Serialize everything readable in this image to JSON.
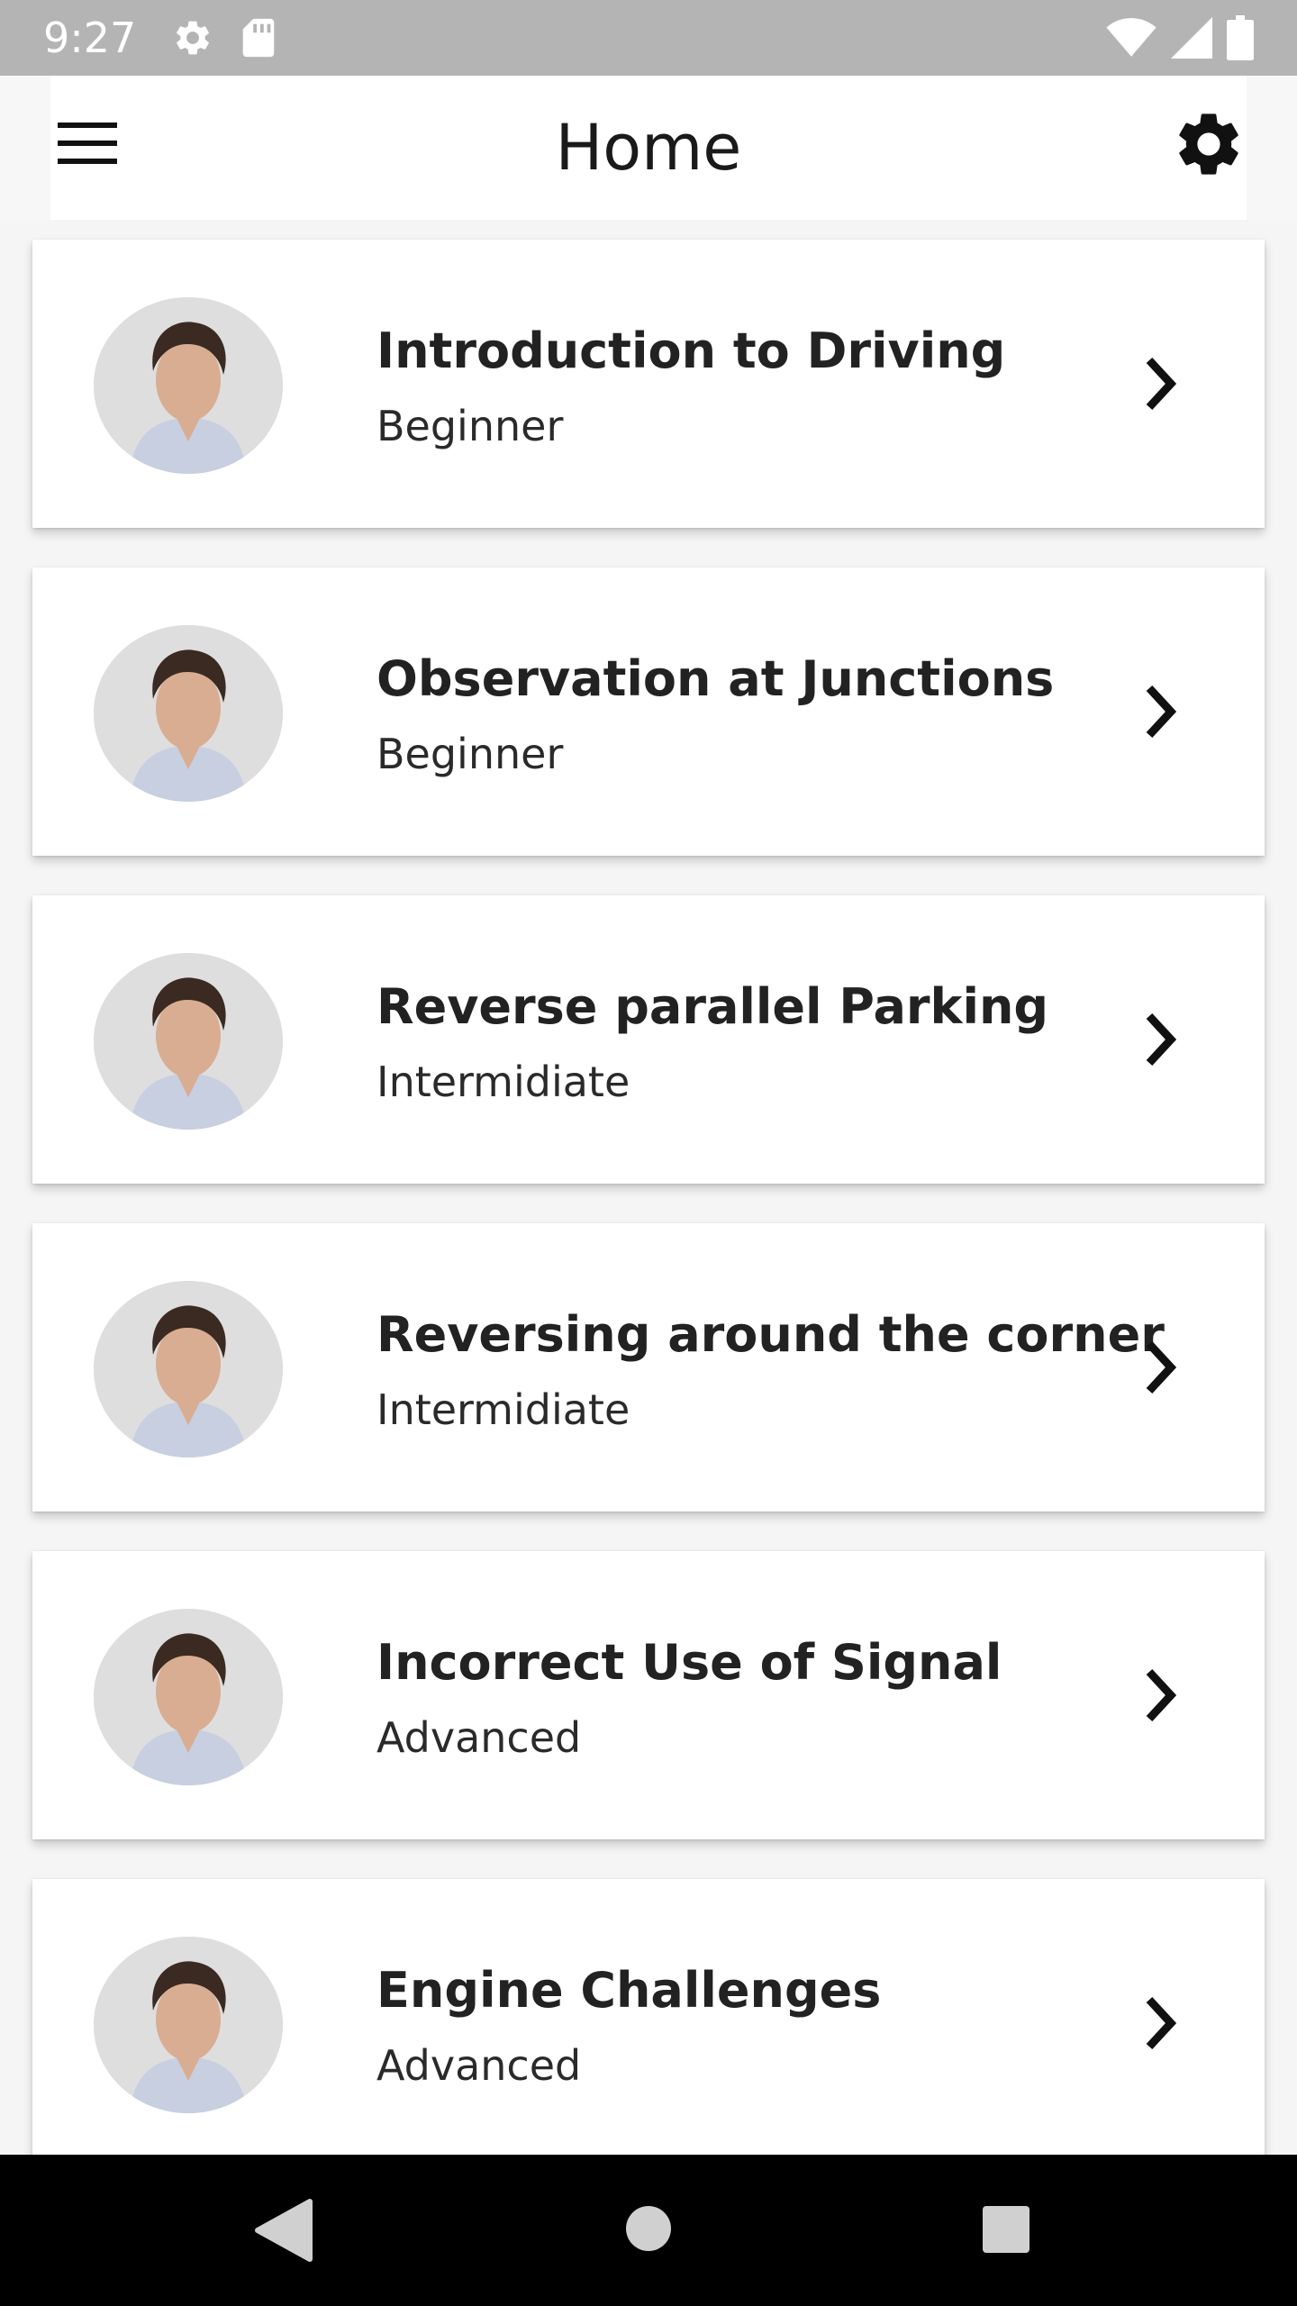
{
  "status_bar": {
    "time": "9:27",
    "icons": [
      "gear-icon",
      "sd-card-icon",
      "wifi-icon",
      "signal-icon",
      "battery-icon"
    ]
  },
  "app_bar": {
    "title": "Home",
    "menu_icon": "hamburger-menu-icon",
    "settings_icon": "gear-icon"
  },
  "lessons": [
    {
      "title": "Introduction to Driving",
      "level": "Beginner"
    },
    {
      "title": "Observation at Junctions",
      "level": "Beginner"
    },
    {
      "title": "Reverse parallel Parking",
      "level": "Intermidiate"
    },
    {
      "title": "Reversing around the corner",
      "level": "Intermidiate"
    },
    {
      "title": "Incorrect Use of Signal",
      "level": "Advanced"
    },
    {
      "title": "Engine Challenges",
      "level": "Advanced"
    }
  ],
  "nav_bar": {
    "icons": [
      "back-icon",
      "home-icon",
      "recents-icon"
    ]
  },
  "colors": {
    "status_bar": "#b4b4b4",
    "background": "#f5f5f5",
    "card": "#ffffff",
    "text_primary": "#222222",
    "nav_bar": "#000000"
  }
}
